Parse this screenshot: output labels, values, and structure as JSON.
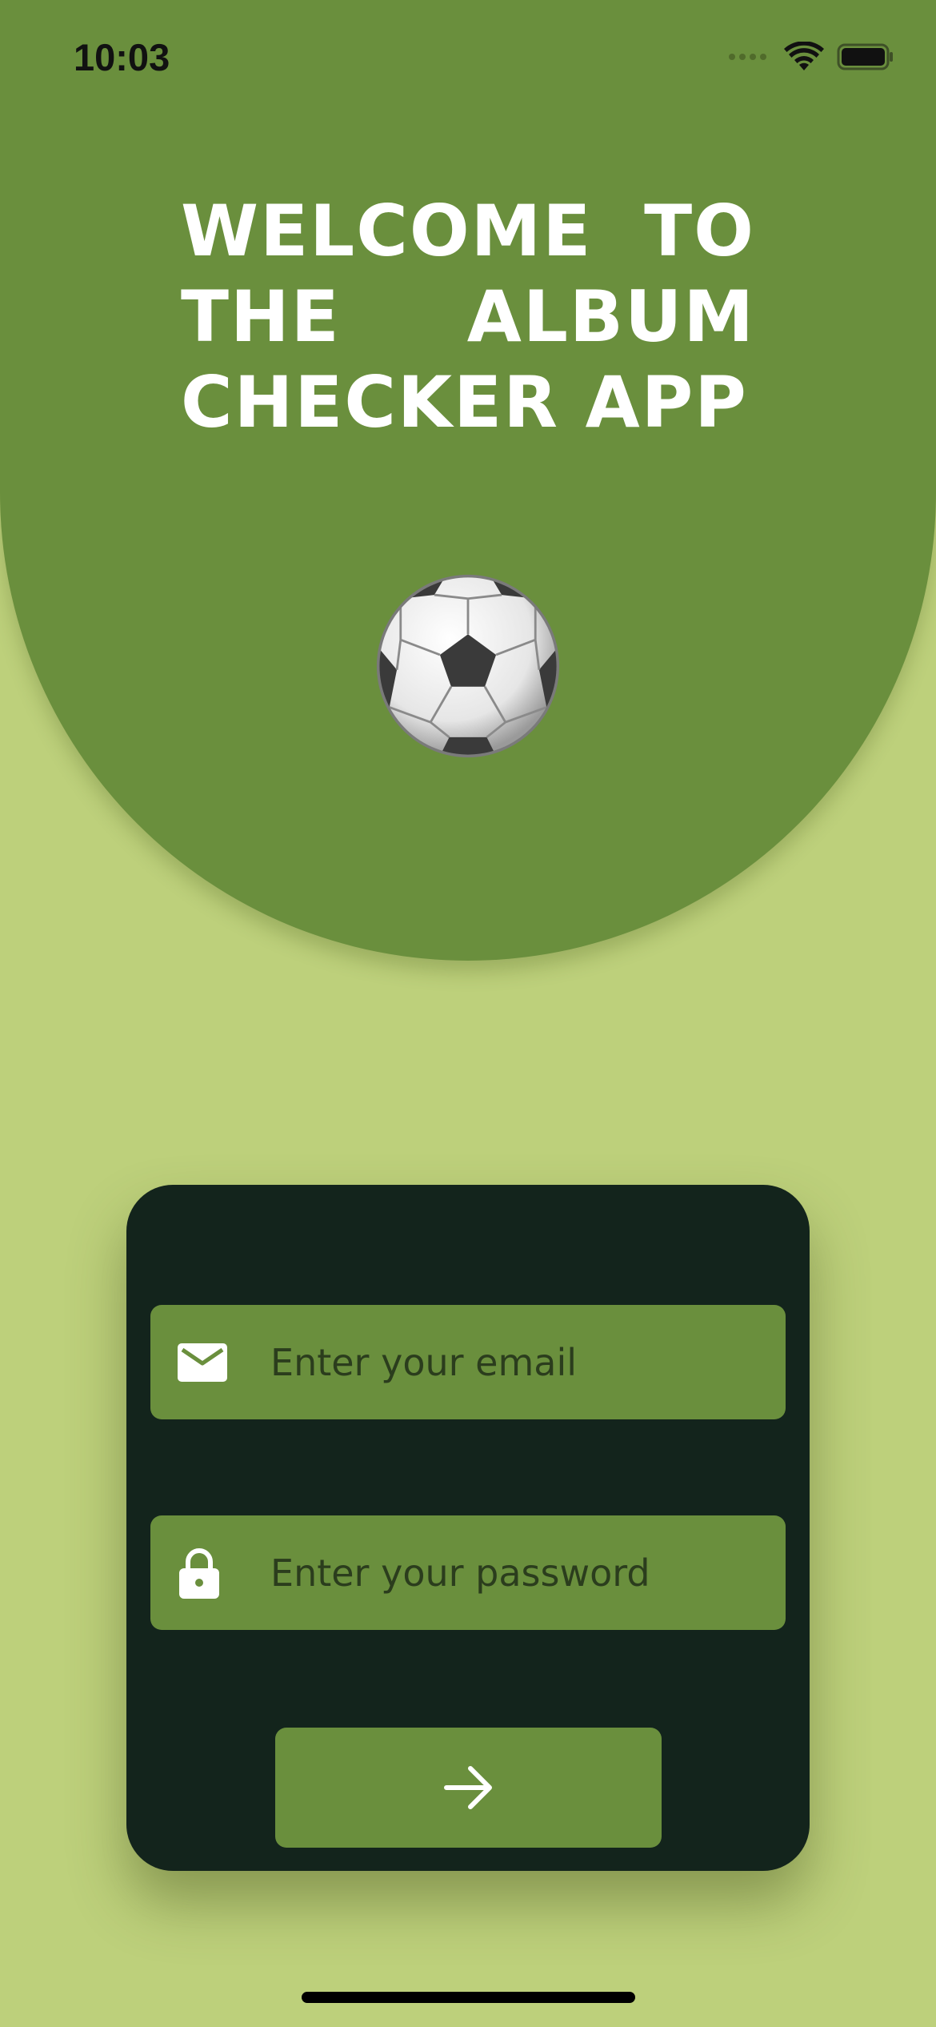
{
  "status_bar": {
    "time": "10:03"
  },
  "hero": {
    "title": "WELCOME TO THE ALBUM CHECKER APP",
    "emoji": "⚽"
  },
  "login": {
    "email": {
      "placeholder": "Enter your email",
      "value": "",
      "icon": "mail-icon"
    },
    "password": {
      "placeholder": "Enter your password",
      "value": "",
      "icon": "lock-icon"
    },
    "submit": {
      "icon": "arrow-right-icon"
    }
  },
  "colors": {
    "background": "#bdd07b",
    "hero": "#6a8f3d",
    "card": "#13241c",
    "field": "#6a8f3d"
  }
}
